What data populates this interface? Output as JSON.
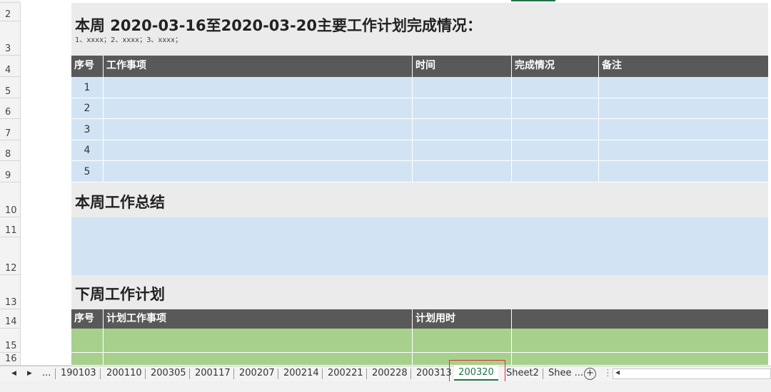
{
  "row_numbers": [
    "2",
    "3",
    "4",
    "5",
    "6",
    "7",
    "8",
    "9",
    "10",
    "11",
    "12",
    "13",
    "14",
    "15",
    "16"
  ],
  "section1": {
    "title": "本周 2020-03-16至2020-03-20主要工作计划完成情况：",
    "subtitle": "1、xxxx；2、xxxx；3、xxxx；"
  },
  "table1": {
    "headers": [
      "序号",
      "工作事项",
      "时间",
      "完成情况",
      "备注"
    ],
    "rows": [
      "1",
      "2",
      "3",
      "4",
      "5"
    ]
  },
  "section2": {
    "title": "本周工作总结"
  },
  "section3": {
    "title": "下周工作计划"
  },
  "table2": {
    "headers": [
      "序号",
      "计划工作事项",
      "计划用时",
      ""
    ]
  },
  "sheet_tabs": {
    "prev_icon": "triangle-left-icon",
    "next_icon": "triangle-right-icon",
    "more": "...",
    "tabs": [
      "190103",
      "200110",
      "200305",
      "200117",
      "200207",
      "200214",
      "200221",
      "200228",
      "200313",
      "200320",
      "Sheet2",
      "Shee ..."
    ],
    "active": "200320",
    "active_color": "#217346",
    "highlight_color": "#e03030"
  },
  "colors": {
    "header_bg": "#595959",
    "blue_fill": "#d2e4f4",
    "green_fill": "#a8d08d",
    "band_bg": "#ebebeb"
  }
}
